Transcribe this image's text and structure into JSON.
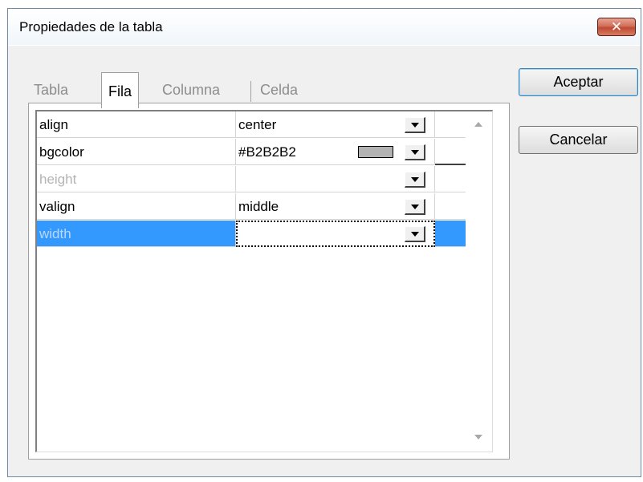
{
  "dialog": {
    "title": "Propiedades de la tabla"
  },
  "tabs": [
    {
      "label": "Tabla",
      "selected": false
    },
    {
      "label": "Fila",
      "selected": true
    },
    {
      "label": "Columna",
      "selected": false
    },
    {
      "label": "Celda",
      "selected": false
    }
  ],
  "properties": [
    {
      "name": "align",
      "value": "center",
      "enabled": true
    },
    {
      "name": "bgcolor",
      "value": "#B2B2B2",
      "enabled": true,
      "swatch_color": "#b2b2b2"
    },
    {
      "name": "height",
      "value": "",
      "enabled": false
    },
    {
      "name": "valign",
      "value": "middle",
      "enabled": true
    },
    {
      "name": "width",
      "value": "",
      "enabled": false,
      "selected": true
    }
  ],
  "buttons": {
    "ok": "Aceptar",
    "cancel": "Cancelar"
  },
  "icons": {
    "close": "close-icon",
    "dropdown": "chevron-down-icon"
  },
  "colors": {
    "selection": "#3399ff",
    "close_button": "#c7503a"
  }
}
